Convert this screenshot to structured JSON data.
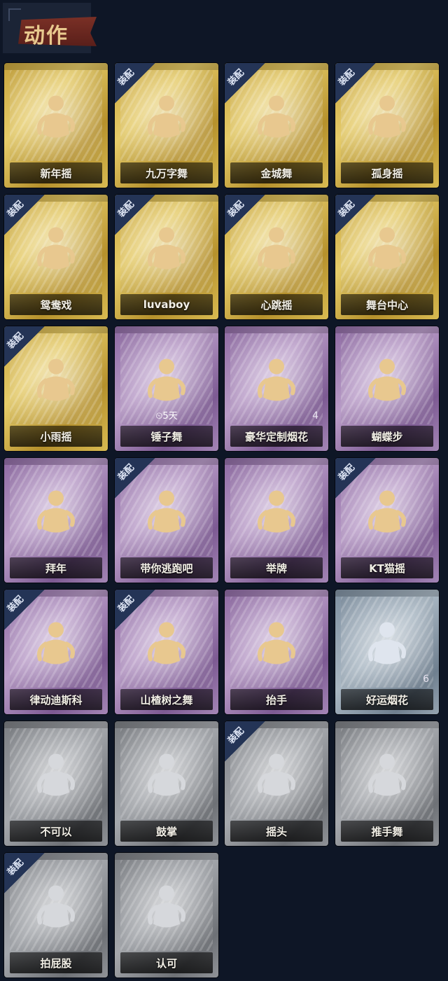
{
  "header": {
    "title": "动作"
  },
  "equipped_badge": "装配",
  "cards": [
    {
      "label": "新年摇",
      "tier": "gold",
      "equipped": false
    },
    {
      "label": "九万字舞",
      "tier": "gold",
      "equipped": true
    },
    {
      "label": "金城舞",
      "tier": "gold",
      "equipped": true
    },
    {
      "label": "孤身摇",
      "tier": "gold",
      "equipped": true
    },
    {
      "label": "鸳鸯戏",
      "tier": "gold",
      "equipped": true
    },
    {
      "label": "luvaboy",
      "tier": "gold",
      "equipped": true
    },
    {
      "label": "心跳摇",
      "tier": "gold",
      "equipped": true
    },
    {
      "label": "舞台中心",
      "tier": "gold",
      "equipped": true
    },
    {
      "label": "小雨摇",
      "tier": "gold",
      "equipped": true
    },
    {
      "label": "锤子舞",
      "tier": "purple",
      "equipped": false,
      "timer": "5天"
    },
    {
      "label": "豪华定制烟花",
      "tier": "purple",
      "equipped": false,
      "count": "4"
    },
    {
      "label": "蝴蝶步",
      "tier": "purple",
      "equipped": false
    },
    {
      "label": "拜年",
      "tier": "purple",
      "equipped": false
    },
    {
      "label": "带你逃跑吧",
      "tier": "purple",
      "equipped": true
    },
    {
      "label": "举牌",
      "tier": "purple",
      "equipped": false
    },
    {
      "label": "KT猫摇",
      "tier": "purple",
      "equipped": true
    },
    {
      "label": "律动迪斯科",
      "tier": "purple",
      "equipped": true
    },
    {
      "label": "山楂树之舞",
      "tier": "purple",
      "equipped": true
    },
    {
      "label": "抬手",
      "tier": "purple",
      "equipped": false
    },
    {
      "label": "好运烟花",
      "tier": "blue",
      "equipped": false,
      "count": "6"
    },
    {
      "label": "不可以",
      "tier": "gray",
      "equipped": false
    },
    {
      "label": "鼓掌",
      "tier": "gray",
      "equipped": false
    },
    {
      "label": "摇头",
      "tier": "gray",
      "equipped": true
    },
    {
      "label": "推手舞",
      "tier": "gray",
      "equipped": false
    },
    {
      "label": "拍屁股",
      "tier": "gray",
      "equipped": true
    },
    {
      "label": "认可",
      "tier": "gray",
      "equipped": false
    }
  ]
}
